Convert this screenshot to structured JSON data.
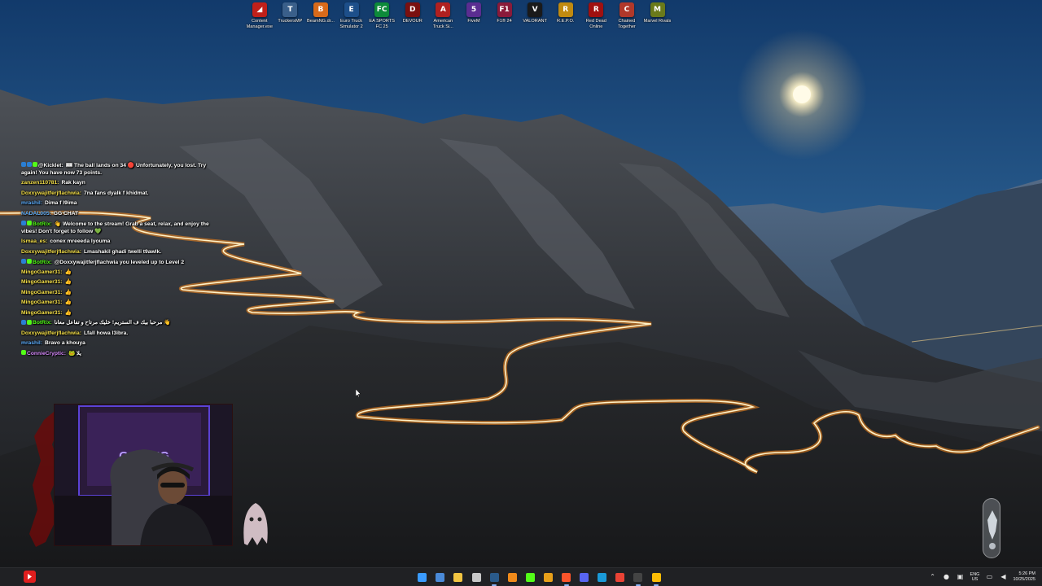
{
  "desktop": {
    "icons": [
      {
        "label": "Content Manager.exe",
        "icon": "content-manager-icon",
        "color": "#c0201a",
        "glyph": "◢"
      },
      {
        "label": "TruckersMP",
        "icon": "truckersmp-icon",
        "color": "#3a5f8a",
        "glyph": "T"
      },
      {
        "label": "BeamNG.dr...",
        "icon": "beamng-icon",
        "color": "#d86a1a",
        "glyph": "B"
      },
      {
        "label": "Euro Truck Simulator 2",
        "icon": "ets2-icon",
        "color": "#1d4f8a",
        "glyph": "E"
      },
      {
        "label": "EA SPORTS FC 25",
        "icon": "easports-fc-icon",
        "color": "#0d8a3a",
        "glyph": "FC"
      },
      {
        "label": "DEVOUR",
        "icon": "devour-icon",
        "color": "#7a1010",
        "glyph": "D"
      },
      {
        "label": "American Truck Si...",
        "icon": "ats-icon",
        "color": "#b02020",
        "glyph": "A"
      },
      {
        "label": "FiveM",
        "icon": "fivem-icon",
        "color": "#5a2d91",
        "glyph": "5"
      },
      {
        "label": "F1® 24",
        "icon": "f1-icon",
        "color": "#8a1a3a",
        "glyph": "F1"
      },
      {
        "label": "VALORANT",
        "icon": "valorant-icon",
        "color": "#1a1a1a",
        "glyph": "V"
      },
      {
        "label": "R.E.P.O.",
        "icon": "repo-icon",
        "color": "#c08a10",
        "glyph": "R"
      },
      {
        "label": "Red Dead Online",
        "icon": "red-dead-online-icon",
        "color": "#a01010",
        "glyph": "R"
      },
      {
        "label": "Chained Together",
        "icon": "chained-together-icon",
        "color": "#b0382a",
        "glyph": "C"
      },
      {
        "label": "Marvel Rivals",
        "icon": "marvel-rivals-icon",
        "color": "#6a7a1a",
        "glyph": "M"
      }
    ]
  },
  "chat": {
    "messages": [
      {
        "user": "@Kicklet:",
        "text": "🎟 The ball lands on 34 🔴 Unfortunately, you lost. Try again! You have now 73 points.",
        "color": "#ffffff",
        "badges": [
          "#2a7fd4",
          "#2a7fd4",
          "#53fc18"
        ],
        "wrap": true
      },
      {
        "user": "zanzen110781:",
        "text": "Rak kayn",
        "color": "#f5e04a",
        "badges": [],
        "wrap": false
      },
      {
        "user": "Doxxywajitferjflachwia:",
        "text": "7na fans dyalk f khidmat.",
        "color": "#f5e04a",
        "badges": [],
        "wrap": false
      },
      {
        "user": "mrashil:",
        "text": "Dima f l9ima",
        "color": "#5fb0ff",
        "badges": [],
        "wrap": false
      },
      {
        "user": "NADAL005:",
        "text": "GG CHAT",
        "color": "#5fb0ff",
        "badges": [],
        "wrap": false
      },
      {
        "user": "BotRix:",
        "text": "👋 Welcome to the stream! Grab a seat, relax, and enjoy the vibes! Don't forget to follow 💚",
        "color": "#53fc18",
        "badges": [
          "#2a7fd4",
          "#53fc18"
        ],
        "wrap": true
      },
      {
        "user": "Ismaa_es:",
        "text": "conex mreeeda lyouma",
        "color": "#f5e04a",
        "badges": [],
        "wrap": false
      },
      {
        "user": "Doxxywajitferjflachwia:",
        "text": "Lmashakil ghadi twelli t9awlk.",
        "color": "#f5e04a",
        "badges": [],
        "wrap": false
      },
      {
        "user": "BotRix:",
        "text": "@Doxxywajitferjflachwia you leveled up to Level 2",
        "color": "#53fc18",
        "badges": [
          "#2a7fd4",
          "#53fc18"
        ],
        "wrap": true
      },
      {
        "user": "MingoGamer31:",
        "text": "👍",
        "color": "#f5e04a",
        "badges": [],
        "wrap": false
      },
      {
        "user": "MingoGamer31:",
        "text": "👍",
        "color": "#f5e04a",
        "badges": [],
        "wrap": false
      },
      {
        "user": "MingoGamer31:",
        "text": "👍",
        "color": "#f5e04a",
        "badges": [],
        "wrap": false
      },
      {
        "user": "MingoGamer31:",
        "text": "👍",
        "color": "#f5e04a",
        "badges": [],
        "wrap": false
      },
      {
        "user": "MingoGamer31:",
        "text": "👍",
        "color": "#f5e04a",
        "badges": [],
        "wrap": false
      },
      {
        "user": "BotRix:",
        "text": "مرحبا بيك ف الستريم! خليك مرتاح و تفاعل معانا 👋",
        "color": "#53fc18",
        "badges": [
          "#2a7fd4",
          "#53fc18"
        ],
        "wrap": false
      },
      {
        "user": "Doxxywajitferjflachwia:",
        "text": "Lfall howa l3ibra.",
        "color": "#f5e04a",
        "badges": [],
        "wrap": false
      },
      {
        "user": "mrashil:",
        "text": "Bravo a khouya",
        "color": "#5fb0ff",
        "badges": [],
        "wrap": false
      },
      {
        "user": "ConnieCryptic:",
        "text": "🐸 يلا",
        "color": "#d98cff",
        "badges": [
          "#53fc18"
        ],
        "wrap": false
      }
    ]
  },
  "webcam": {
    "sign_text": "GAMING",
    "accent": "#7a3cff"
  },
  "taskbar": {
    "pinned": [
      {
        "icon": "start-windows-icon",
        "color": "#3a9bff",
        "active": false
      },
      {
        "icon": "calendar-app-icon",
        "color": "#4a8ad8",
        "active": false
      },
      {
        "icon": "file-explorer-icon",
        "color": "#f2c542",
        "active": false
      },
      {
        "icon": "snipping-tool-icon",
        "color": "#c8c8c8",
        "active": false
      },
      {
        "icon": "steam-icon",
        "color": "#2a5a8a",
        "active": true
      },
      {
        "icon": "vlc-icon",
        "color": "#f08a1a",
        "active": false
      },
      {
        "icon": "kick-icon",
        "color": "#53fc18",
        "active": false
      },
      {
        "icon": "rockstar-icon",
        "color": "#e8a01a",
        "active": false
      },
      {
        "icon": "brave-icon",
        "color": "#fb542b",
        "active": true
      },
      {
        "icon": "discord-icon",
        "color": "#5865f2",
        "active": false
      },
      {
        "icon": "edge-icon",
        "color": "#1a9ad8",
        "active": false
      },
      {
        "icon": "chrome-icon",
        "color": "#ea4335",
        "active": false
      },
      {
        "icon": "obs-icon",
        "color": "#444444",
        "active": true
      },
      {
        "icon": "google-chrome-icon",
        "color": "#fbbc05",
        "active": true
      }
    ],
    "lang_top": "ENG",
    "lang_bottom": "US",
    "time": "5:26 PM",
    "date": "10/25/2025"
  }
}
